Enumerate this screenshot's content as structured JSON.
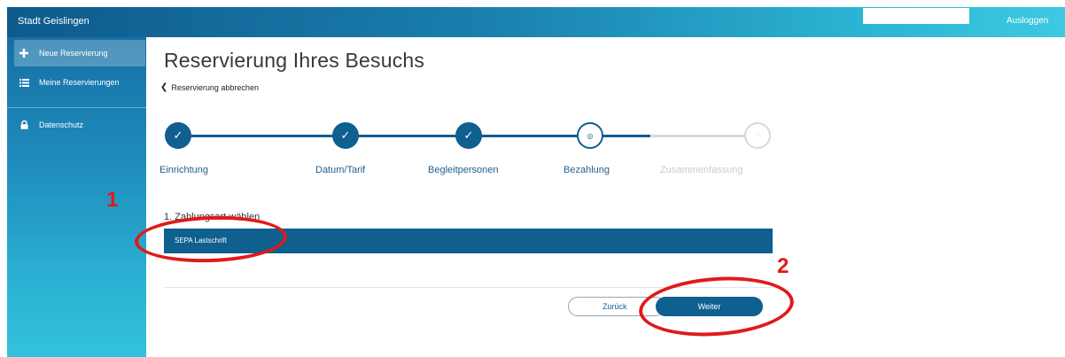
{
  "header": {
    "brand": "Stadt Geislingen",
    "logout_label": "Ausloggen"
  },
  "sidebar": {
    "items": [
      {
        "label": "Neue Reservierung",
        "icon": "plus-icon",
        "active": true
      },
      {
        "label": "Meine Reservierungen",
        "icon": "list-icon",
        "active": false
      },
      {
        "label": "Datenschutz",
        "icon": "lock-icon",
        "active": false
      }
    ]
  },
  "main": {
    "title": "Reservierung Ihres Besuchs",
    "back_label": "Reservierung abbrechen",
    "steps": [
      {
        "label": "Einrichtung",
        "state": "done"
      },
      {
        "label": "Datum/Tarif",
        "state": "done"
      },
      {
        "label": "Begleitpersonen",
        "state": "done"
      },
      {
        "label": "Bezahlung",
        "state": "current"
      },
      {
        "label": "Zusammenfassung",
        "state": "future"
      }
    ],
    "payment_section_label": "1. Zahlungsart wählen",
    "payment_option": "SEPA Lastschrift",
    "back_button": "Zurück",
    "next_button": "Weiter"
  },
  "annotations": {
    "marker_1": "1",
    "marker_2": "2",
    "color": "#e01a1a"
  },
  "colors": {
    "primary": "#0f5f8f",
    "inactive": "#d6d9dc"
  }
}
